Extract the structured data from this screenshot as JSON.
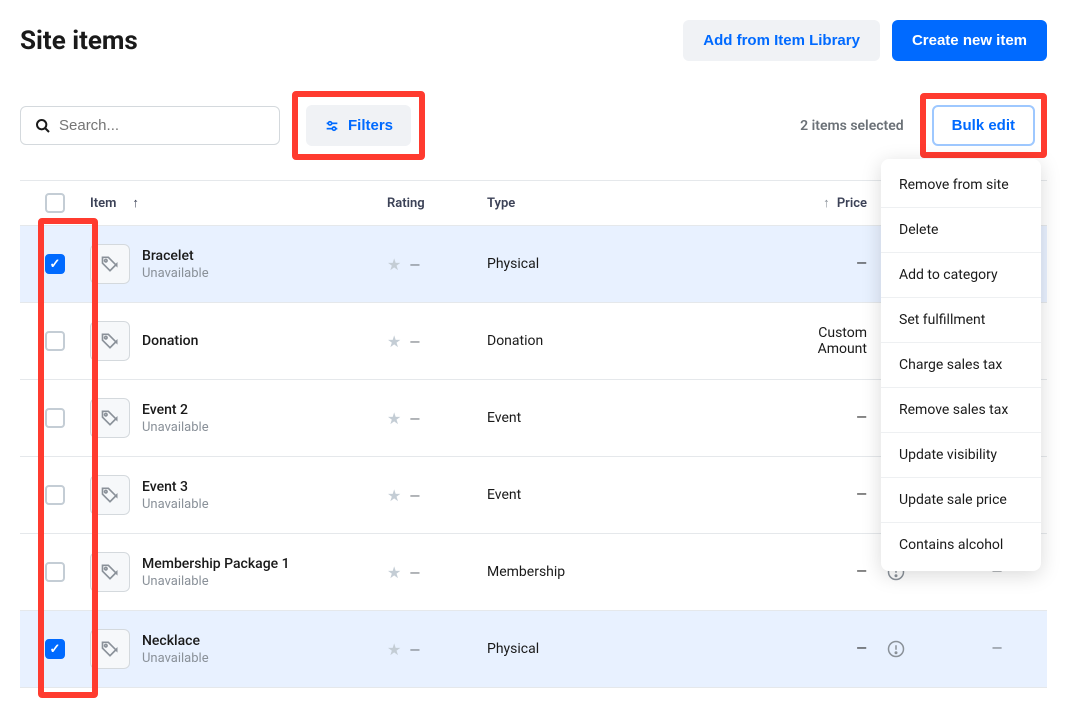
{
  "page_title": "Site items",
  "header": {
    "library_btn": "Add from Item Library",
    "create_btn": "Create new item"
  },
  "toolbar": {
    "search_placeholder": "Search...",
    "filters_label": "Filters",
    "selected_text": "2 items selected",
    "bulk_label": "Bulk edit"
  },
  "bulk_menu": [
    "Remove from site",
    "Delete",
    "Add to category",
    "Set fulfillment",
    "Charge sales tax",
    "Remove sales tax",
    "Update visibility",
    "Update sale price",
    "Contains alcohol"
  ],
  "columns": {
    "item": "Item",
    "rating": "Rating",
    "type": "Type",
    "price": "Price"
  },
  "rows": [
    {
      "name": "Bracelet",
      "sub": "Unavailable",
      "type": "Physical",
      "price": "—",
      "alert": true,
      "action": "—",
      "checked": true
    },
    {
      "name": "Donation",
      "sub": "",
      "type": "Donation",
      "price": "Custom Amount",
      "alert": false,
      "action": "",
      "checked": false
    },
    {
      "name": "Event 2",
      "sub": "Unavailable",
      "type": "Event",
      "price": "—",
      "alert": true,
      "action": "—",
      "checked": false
    },
    {
      "name": "Event 3",
      "sub": "Unavailable",
      "type": "Event",
      "price": "—",
      "alert": true,
      "action": "—",
      "checked": false
    },
    {
      "name": "Membership Package 1",
      "sub": "Unavailable",
      "type": "Membership",
      "price": "—",
      "alert": true,
      "action": "—",
      "checked": false
    },
    {
      "name": "Necklace",
      "sub": "Unavailable",
      "type": "Physical",
      "price": "—",
      "alert": true,
      "action": "—",
      "checked": true
    }
  ]
}
